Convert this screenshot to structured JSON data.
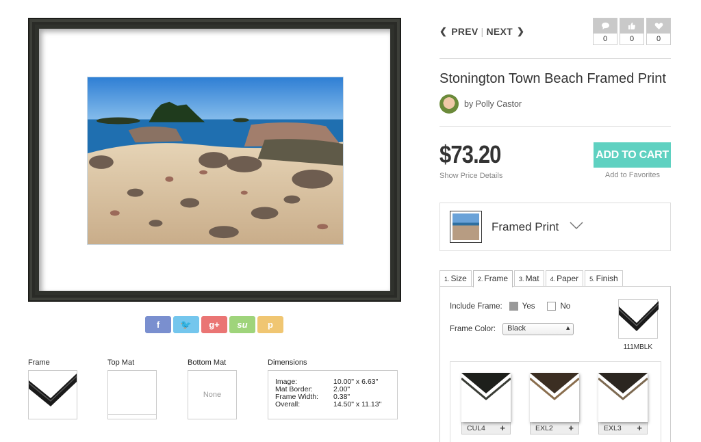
{
  "artwork": {
    "title": "Stonington Town Beach Framed Print"
  },
  "social": {
    "facebook": "f",
    "twitter": "🐦",
    "googleplus": "g+",
    "stumbleupon": "su",
    "pinterest": "p"
  },
  "details": {
    "frame_label": "Frame",
    "top_mat_label": "Top Mat",
    "bottom_mat_label": "Bottom Mat",
    "bottom_mat_value": "None",
    "dimensions_label": "Dimensions",
    "dimensions": [
      {
        "k": "Image:",
        "v": "10.00\" x 6.63\""
      },
      {
        "k": "Mat Border:",
        "v": "2.00\""
      },
      {
        "k": "Frame Width:",
        "v": "0.38\""
      },
      {
        "k": "Overall:",
        "v": "14.50\" x 11.13\""
      }
    ]
  },
  "nav": {
    "prev": "PREV",
    "next": "NEXT"
  },
  "counters": {
    "comments": "0",
    "likes": "0",
    "favorites": "0"
  },
  "product": {
    "title": "Stonington Town Beach Framed Print",
    "artist": "by Polly Castor",
    "price": "$73.20",
    "price_details": "Show Price Details",
    "add_to_cart": "ADD TO CART",
    "add_to_favorites": "Add to Favorites",
    "type": "Framed Print"
  },
  "tabs": [
    {
      "num": "1.",
      "label": "Size"
    },
    {
      "num": "2.",
      "label": "Frame"
    },
    {
      "num": "3.",
      "label": "Mat"
    },
    {
      "num": "4.",
      "label": "Paper"
    },
    {
      "num": "5.",
      "label": "Finish"
    }
  ],
  "frame_panel": {
    "include_label": "Include Frame:",
    "yes": "Yes",
    "no": "No",
    "color_label": "Frame Color:",
    "color_value": "Black",
    "selected_code": "111MBLK",
    "options": [
      {
        "code": "CUL4",
        "plus": "+"
      },
      {
        "code": "EXL2",
        "plus": "+"
      },
      {
        "code": "EXL3",
        "plus": "+"
      }
    ]
  },
  "colors": {
    "accent": "#5fd1c1",
    "frame": "#2f312c"
  }
}
